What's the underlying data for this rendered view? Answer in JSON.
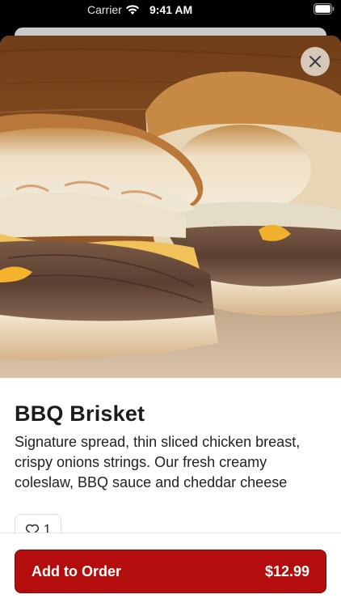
{
  "status_bar": {
    "carrier": "Carrier",
    "time": "9:41 AM",
    "icons": [
      "wifi-icon",
      "battery-icon"
    ]
  },
  "modal": {
    "close_icon": "close-icon",
    "image_subject": "sandwich-photo"
  },
  "product": {
    "title": "BBQ Brisket",
    "description": "Signature spread, thin sliced chicken breast, crispy onions strings. Our fresh creamy coleslaw, BBQ sauce and cheddar cheese",
    "likes": "1",
    "like_icon": "heart-icon"
  },
  "order_button": {
    "label": "Add to Order",
    "price": "$12.99",
    "color": "#b30d0d"
  }
}
